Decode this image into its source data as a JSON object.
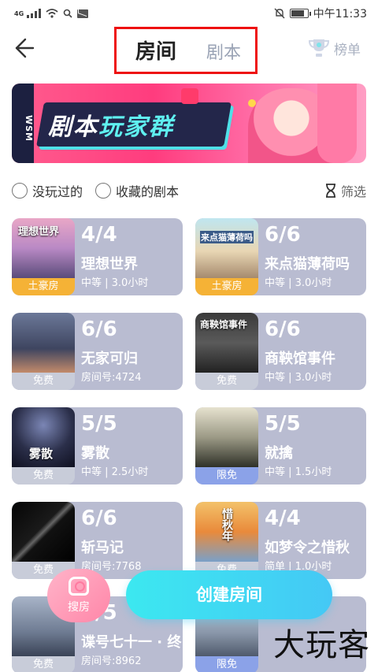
{
  "status_bar": {
    "network": "4G",
    "time": "中午11:33"
  },
  "header": {
    "tabs": [
      {
        "label": "房间",
        "active": true
      },
      {
        "label": "剧本",
        "active": false
      }
    ],
    "ranking_label": "榜单"
  },
  "banner": {
    "side_text": "WSM",
    "title_main": "剧本",
    "title_accent": "玩家群"
  },
  "filters": {
    "options": [
      "没玩过的",
      "收藏的剧本"
    ],
    "filter_label": "筛选"
  },
  "rooms": [
    {
      "cover_text": "理想世界",
      "tag": "土豪房",
      "count": "4/4",
      "name": "理想世界",
      "meta": "中等 | 3.0小时"
    },
    {
      "cover_text": "来点猫薄荷吗",
      "tag": "土豪房",
      "count": "6/6",
      "name": "来点猫薄荷吗",
      "meta": "中等 | 3.0小时"
    },
    {
      "cover_text": "",
      "tag": "免费",
      "count": "6/6",
      "name": "无家可归",
      "meta": "房间号:4724"
    },
    {
      "cover_text": "商鞅馆事件",
      "tag": "免费",
      "count": "6/6",
      "name": "商鞅馆事件",
      "meta": "中等 | 3.0小时"
    },
    {
      "cover_text": "雾散",
      "tag": "免费",
      "count": "5/5",
      "name": "雾散",
      "meta": "中等 | 2.5小时"
    },
    {
      "cover_text": "",
      "tag": "限免",
      "count": "5/5",
      "name": "就擒",
      "meta": "中等 | 1.5小时"
    },
    {
      "cover_text": "",
      "tag": "免费",
      "count": "6/6",
      "name": "斩马记",
      "meta": "房间号:7768"
    },
    {
      "cover_text": "惜秋年",
      "tag": "免费",
      "count": "4/4",
      "name": "如梦令之惜秋",
      "meta": "简单 | 1.0小时"
    },
    {
      "cover_text": "",
      "tag": "免费",
      "count": "5/5",
      "name": "谍号七十一 · 终",
      "meta": "房间号:8962"
    },
    {
      "cover_text": "",
      "tag": "限免",
      "count": "",
      "name": "",
      "meta": ""
    }
  ],
  "actions": {
    "search_room": "搜房",
    "create_room": "创建房间"
  },
  "watermark": "大玩客"
}
